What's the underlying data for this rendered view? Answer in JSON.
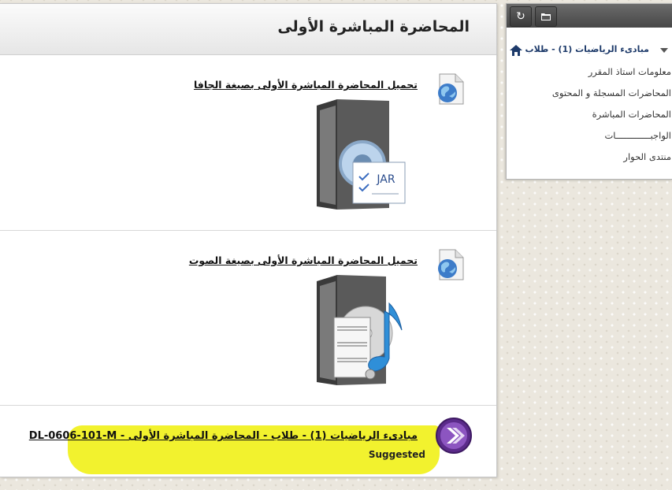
{
  "page": {
    "title": "المحاضرة المباشرة الأولى"
  },
  "items": [
    {
      "title": "تحميل المحاضرة المباشرة الأولى بصيغة الجافا",
      "icon": "globe-file-icon",
      "image": "jar-folder-icon",
      "image_label": "JAR"
    },
    {
      "title": "تحميل المحاضرة المباشرة الأولى بصيغة الصوت",
      "icon": "globe-file-icon",
      "image": "music-folder-icon"
    },
    {
      "title": "مبادىء الرياضيات (1) - طلاب - المحاضرة المباشرة الأولى - DL-0606-101-M",
      "badge": "Suggested",
      "icon": "purple-arrow-icon",
      "highlight_color": "#f2f22e"
    }
  ],
  "course_menu": {
    "course_name": "مبادىء الرياضيات (1) - طلاب",
    "links": [
      "معلومات استاذ المقرر",
      "المحاضرات المسجلة و المحتوى",
      "المحاضرات المباشرة",
      "الواجبـــــــــــــات",
      "منتدى الحوار"
    ]
  },
  "colors": {
    "course_name": "#1d3a6a",
    "toolbar": "#4f4f4f",
    "highlight": "#f2f22e"
  }
}
